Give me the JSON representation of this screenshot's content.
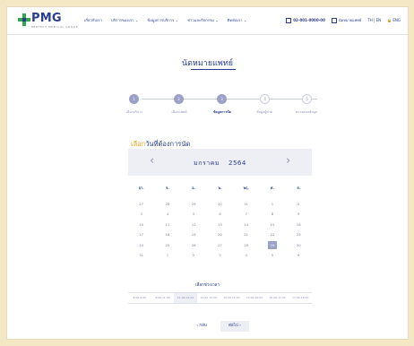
{
  "header": {
    "logo": "PMG",
    "logo_sub": "PERFECT MEDICAL GROUP",
    "nav": [
      "เกี่ยวกับเรา",
      "บริการของเรา ⌄",
      "ข้อมูลการบริการ ⌄",
      "ข่าวและกิจกรรม ⌄",
      "ติดต่อเรา ⌄"
    ],
    "phone": "02-001-0000-00",
    "contact": "นัดหมายแพทย์",
    "lang": "TH | EN",
    "account": "🔒 ENG"
  },
  "title": "นัดหมายแพทย์",
  "steps": [
    {
      "num": "1",
      "label": "เลือกบริการ"
    },
    {
      "num": "2",
      "label": "เลือกแพทย์"
    },
    {
      "num": "3",
      "label": "ข้อมูลการนัด"
    },
    {
      "num": "4",
      "label": "ข้อมูลผู้ป่วย"
    },
    {
      "num": "5",
      "label": "ตรวจสอบข้อมูล"
    }
  ],
  "select_date": {
    "prefix": "เลือก",
    "rest": "วันที่ต้องการนัด"
  },
  "calendar": {
    "month": "มกราคม",
    "year": "2564",
    "prev": "‹",
    "next": "›",
    "weekdays": [
      "อา.",
      "จ.",
      "อ.",
      "พ.",
      "พฤ.",
      "ศ.",
      "ส."
    ],
    "weeks": [
      [
        "27",
        "28",
        "29",
        "30",
        "31",
        "1",
        "2"
      ],
      [
        "3",
        "4",
        "5",
        "6",
        "7",
        "8",
        "9"
      ],
      [
        "10",
        "11",
        "12",
        "13",
        "14",
        "15",
        "16"
      ],
      [
        "17",
        "18",
        "19",
        "20",
        "21",
        "22",
        "23"
      ],
      [
        "24",
        "25",
        "26",
        "27",
        "28",
        "29",
        "30"
      ],
      [
        "31",
        "1",
        "2",
        "3",
        "4",
        "5",
        "6"
      ]
    ],
    "selected": "29"
  },
  "time": {
    "title": "เลือกช่วงเวลา",
    "slots": [
      "8:00-9:00",
      "9:00-11:00",
      "11:00-12:00",
      "12:00-13:00",
      "13:00-15:00",
      "15:00-16:00",
      "16:00-17:00",
      "17:00-18:00"
    ],
    "selected": "11:00-12:00"
  },
  "buttons": {
    "back": "‹   กลับ",
    "next": "ต่อไป   ›"
  }
}
